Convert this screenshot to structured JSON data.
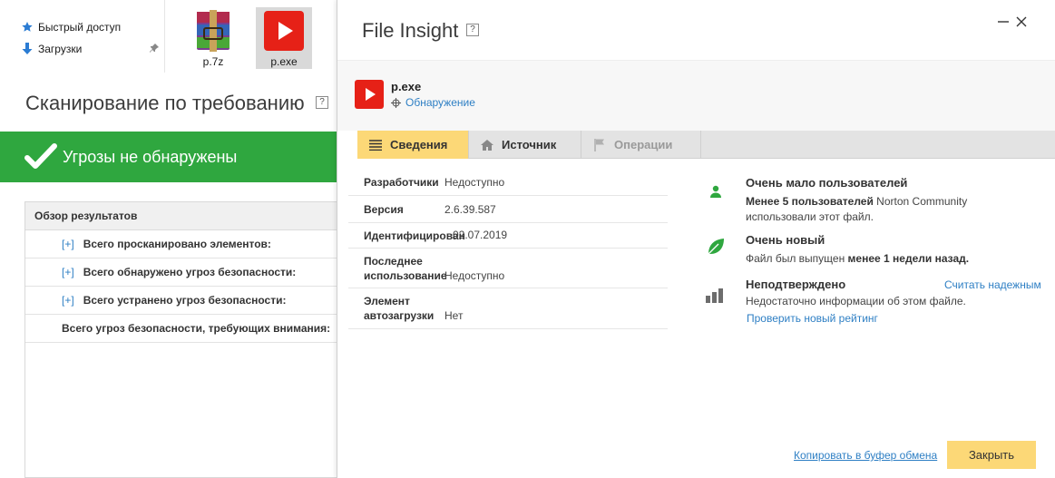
{
  "explorer": {
    "nav": [
      {
        "label": "Быстрый доступ",
        "icon": "star-icon"
      },
      {
        "label": "Загрузки",
        "icon": "download-arrow-icon"
      }
    ],
    "files": [
      {
        "name": "p.7z",
        "icon": "winrar-archive-icon",
        "selected": false
      },
      {
        "name": "p.exe",
        "icon": "youtube-play-icon",
        "selected": true
      }
    ]
  },
  "scan": {
    "title": "Сканирование по требованию",
    "help": "?",
    "status": "Угрозы не обнаружены",
    "status_color": "#2fa73f",
    "results_header": "Обзор результатов",
    "expand_label": "[+]",
    "rows": [
      {
        "label": "Всего просканировано элементов:",
        "expandable": true
      },
      {
        "label": "Всего обнаружено угроз безопасности:",
        "expandable": true
      },
      {
        "label": "Всего устранено угроз безопасности:",
        "expandable": true
      },
      {
        "label": "Всего угроз безопасности, требующих внимания:",
        "expandable": false
      }
    ]
  },
  "dialog": {
    "title": "File Insight",
    "help": "?",
    "minimize": "—",
    "close": "✕",
    "file": {
      "name": "p.exe",
      "detection_link": "Обнаружение"
    },
    "tabs": [
      {
        "label": "Сведения",
        "icon": "list-icon",
        "active": true,
        "enabled": true
      },
      {
        "label": "Источник",
        "icon": "home-icon",
        "active": false,
        "enabled": true
      },
      {
        "label": "Операции",
        "icon": "flag-icon",
        "active": false,
        "enabled": false
      }
    ],
    "details": [
      {
        "key": "Разработчики",
        "value": "Недоступно"
      },
      {
        "key": "Версия",
        "value": "2.6.39.587"
      },
      {
        "key": "Идентифицирован",
        "value": "02.07.2019"
      },
      {
        "key": "Последнее использование",
        "value": "Недоступно"
      },
      {
        "key": "Элемент автозагрузки",
        "value": "Нет"
      }
    ],
    "insights": {
      "users": {
        "title": "Очень мало пользователей",
        "desc_bold": "Менее 5 пользователей",
        "desc_rest1": " Norton Community",
        "desc_rest2": "использовали этот файл."
      },
      "age": {
        "title": "Очень новый",
        "desc_pre": "Файл был выпущен ",
        "desc_bold": "менее 1 недели назад."
      },
      "rating": {
        "title": "Неподтверждено",
        "trust_link": "Считать надежным",
        "desc": "Недостаточно информации об этом файле.",
        "check_link": "Проверить новый рейтинг"
      }
    },
    "copy_link": "Копировать в буфер обмена",
    "close_button": "Закрыть",
    "accent_color": "#fcd877"
  }
}
